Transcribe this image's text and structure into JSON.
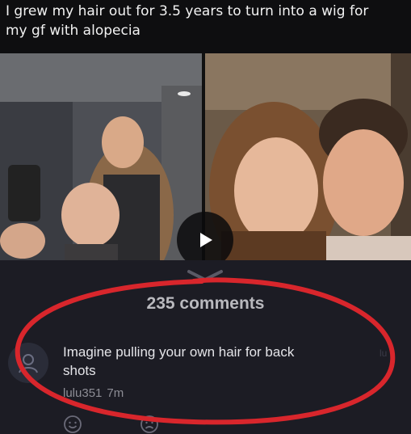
{
  "caption": {
    "line1": "I grew my hair out for 3.5 years to turn into a wig for",
    "line2": "my gf with alopecia"
  },
  "video": {
    "play_icon": "play-icon",
    "expand_icon": "chevron-down-icon"
  },
  "comments": {
    "count_label": "235 comments",
    "items": [
      {
        "avatar_icon": "user-icon",
        "line1": "Imagine pulling your own hair for back",
        "line2": "shots",
        "author": "lulu351",
        "time": "7m"
      }
    ],
    "side_label": "lu"
  },
  "reactions": {
    "happy_icon": "smile-icon",
    "sad_icon": "frown-icon"
  },
  "colors": {
    "background": "#1c1c24",
    "caption_bg": "#0e0e10",
    "highlight_red": "#d8262c"
  }
}
